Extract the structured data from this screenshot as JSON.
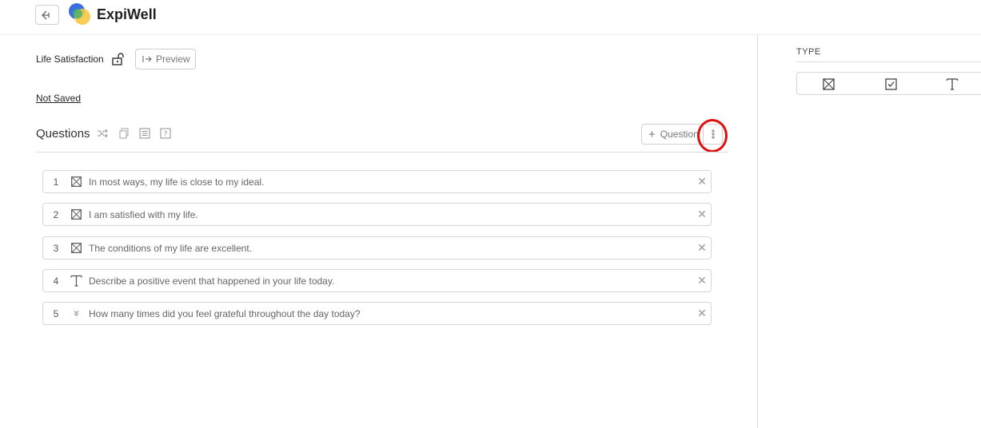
{
  "app": {
    "brand": "ExpiWell"
  },
  "survey": {
    "title": "Life Satisfaction",
    "preview_label": "Preview",
    "status": "Not Saved"
  },
  "questions_section": {
    "header": "Questions",
    "add_label": "Question",
    "items": [
      {
        "number": "1",
        "type": "multiple-choice",
        "text": "In most ways, my life is close to my ideal."
      },
      {
        "number": "2",
        "type": "multiple-choice",
        "text": "I am satisfied with my life."
      },
      {
        "number": "3",
        "type": "multiple-choice",
        "text": "The conditions of my life are excellent."
      },
      {
        "number": "4",
        "type": "text",
        "text": "Describe a positive event that happened in your life today."
      },
      {
        "number": "5",
        "type": "numeric",
        "text": "How many times did you feel grateful throughout the day today?"
      }
    ]
  },
  "type_panel": {
    "label": "TYPE",
    "options": [
      "multiple-choice-icon",
      "checkbox-icon",
      "text-type-icon"
    ]
  },
  "colors": {
    "highlight": "#e01010",
    "border": "#d6d6d6"
  }
}
